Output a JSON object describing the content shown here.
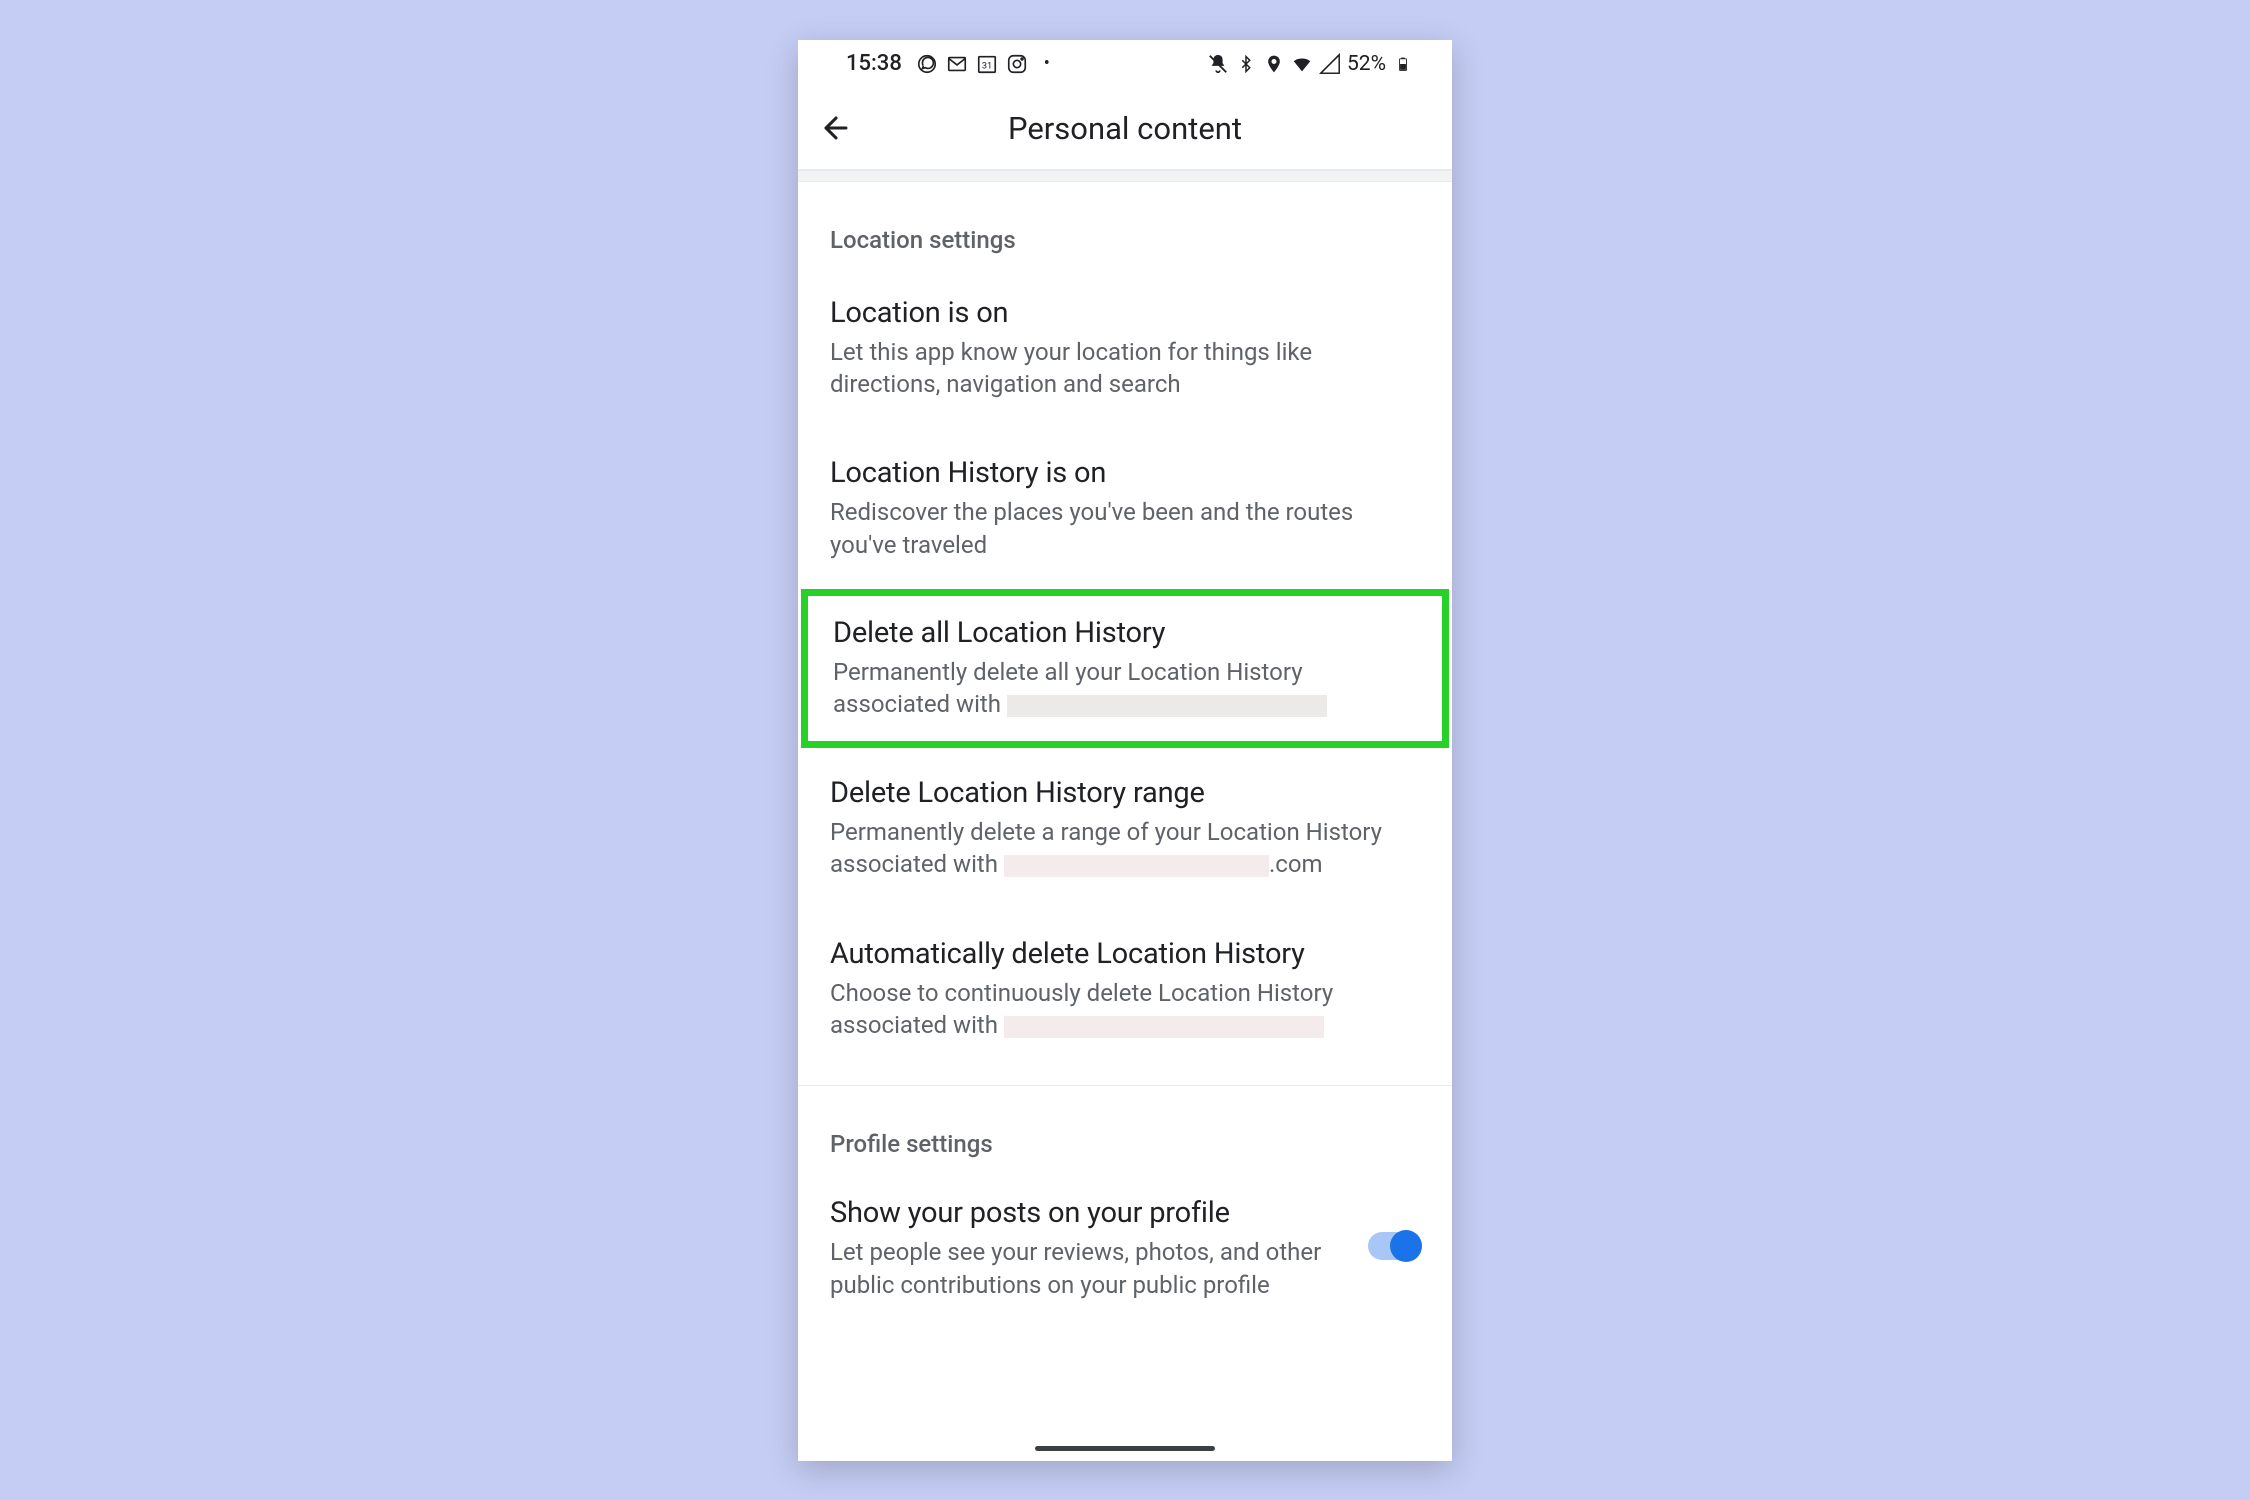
{
  "status": {
    "time": "15:38",
    "battery_pct": "52%"
  },
  "header": {
    "title": "Personal content"
  },
  "sections": {
    "location": {
      "header": "Location settings",
      "location_on": {
        "title": "Location is on",
        "desc": "Let this app know your location for things like directions, navigation and search"
      },
      "history_on": {
        "title": "Location History is on",
        "desc": "Rediscover the places you've been and the routes you've traveled"
      },
      "delete_all": {
        "title": "Delete all Location History",
        "desc": "Permanently delete all your Location History associated with "
      },
      "delete_range": {
        "title": "Delete Location History range",
        "desc_pre": "Permanently delete a range of your Location History associated with ",
        "desc_post": ".com"
      },
      "auto_delete": {
        "title": "Automatically delete Location History",
        "desc": "Choose to continuously delete Location History associated with "
      }
    },
    "profile": {
      "header": "Profile settings",
      "show_posts": {
        "title": "Show your posts on your profile",
        "desc": "Let people see your reviews, photos, and other public contributions on your public profile",
        "toggle_on": true
      }
    }
  }
}
